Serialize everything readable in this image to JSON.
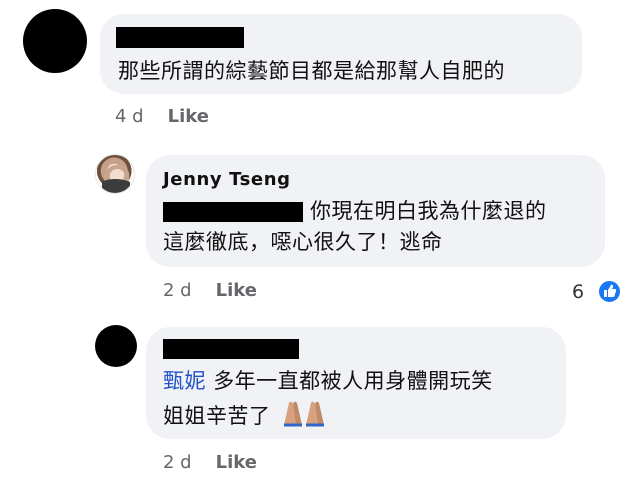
{
  "comments": [
    {
      "author": "",
      "text": "那些所謂的綜藝節目都是給那幫人自肥的",
      "time": "4 d",
      "action": "Like"
    },
    {
      "author": "Jenny  Tseng",
      "line1": "你現在明白我為什麼退的",
      "line2": "這麼徹底，噁心很久了！逃命",
      "time": "2 d",
      "action": "Like",
      "reaction_count": "6"
    },
    {
      "author": "",
      "tag": "甄妮",
      "line1": "多年一直都被人用身體開玩笑",
      "line2": "姐姐辛苦了",
      "emoji_count": 2,
      "time": "2 d",
      "action": "Like"
    }
  ],
  "icons": {
    "reaction": "like-thumb-icon",
    "emoji": "folded-hands-icon"
  }
}
